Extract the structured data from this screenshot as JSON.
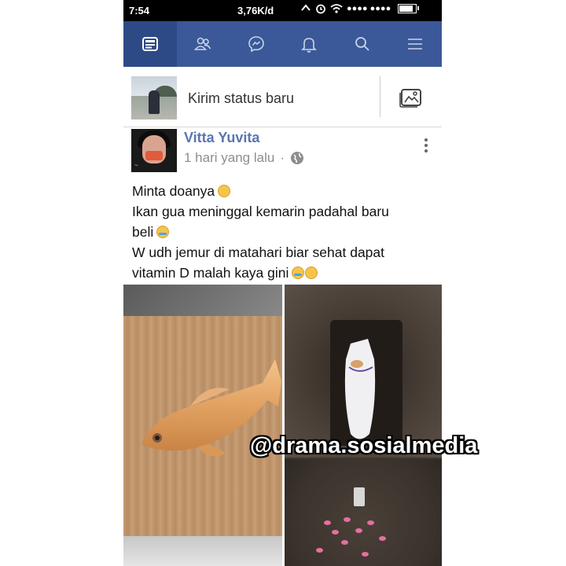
{
  "status_bar": {
    "time": "7:54",
    "network_speed": "3,76K/d",
    "signal_dots": "●●●● ●●●●"
  },
  "nav": {
    "tabs": [
      {
        "icon": "news-feed-icon",
        "active": true
      },
      {
        "icon": "friends-icon",
        "active": false
      },
      {
        "icon": "messenger-icon",
        "active": false
      },
      {
        "icon": "notifications-bell-icon",
        "active": false
      },
      {
        "icon": "search-icon",
        "active": false
      },
      {
        "icon": "menu-icon",
        "active": false
      }
    ],
    "bar_color": "#3b5998"
  },
  "composer": {
    "prompt": "Kirim status baru",
    "photo_button_icon": "photo-gallery-icon"
  },
  "post": {
    "author": "Vitta Yuvita",
    "timestamp": "1 hari yang lalu",
    "separator": "·",
    "privacy_icon": "globe-icon",
    "text_lines": [
      "Minta doanya",
      "Ikan gua meninggal kemarin padahal baru",
      "beli",
      "W udh jemur di matahari biar sehat dapat",
      "vitamin D malah kaya gini"
    ],
    "author_color": "#5a76b0"
  },
  "watermark": "@drama.sosialmedia"
}
